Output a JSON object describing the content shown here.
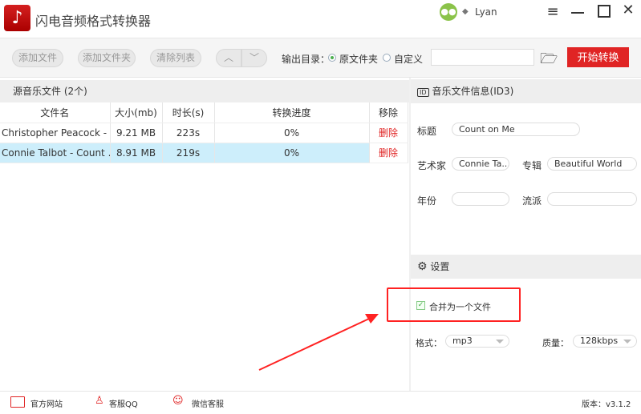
{
  "app": {
    "title": "闪电音频格式转换器",
    "user": "Lyan"
  },
  "toolbar": {
    "add_file": "添加文件",
    "add_folder": "添加文件夹",
    "clear_list": "清除列表",
    "output_label": "输出目录：",
    "opt_original": "原文件夹",
    "opt_custom": "自定义",
    "output_path": "",
    "start": "开始转换"
  },
  "files": {
    "header": "源音乐文件 (2个)",
    "columns": [
      "文件名",
      "大小(mb)",
      "时长(s)",
      "转换进度",
      "移除"
    ],
    "rows": [
      {
        "name": "Christopher Peacock - ...",
        "size": "9.21 MB",
        "duration": "223s",
        "progress": "0%",
        "remove": "删除"
      },
      {
        "name": "Connie Talbot - Count ...",
        "size": "8.91 MB",
        "duration": "219s",
        "progress": "0%",
        "remove": "删除"
      }
    ]
  },
  "id3": {
    "header": "音乐文件信息(ID3)",
    "icon_text": "ID",
    "title_label": "标题",
    "title": "Count on Me",
    "artist_label": "艺术家",
    "artist": "Connie Ta...",
    "album_label": "专辑",
    "album": "Beautiful World",
    "year_label": "年份",
    "year": "",
    "genre_label": "流派",
    "genre": ""
  },
  "settings": {
    "header": "设置",
    "merge": "合并为一个文件",
    "merge_checked": true,
    "format_label": "格式：",
    "format": "mp3",
    "quality_label": "质量：",
    "quality": "128kbps"
  },
  "footer": {
    "website": "官方网站",
    "qq": "客服QQ",
    "wechat": "微信客服",
    "version": "版本：v3.1.2"
  },
  "colors": {
    "accent": "#e02424",
    "selected_row": "#cdeefb"
  }
}
